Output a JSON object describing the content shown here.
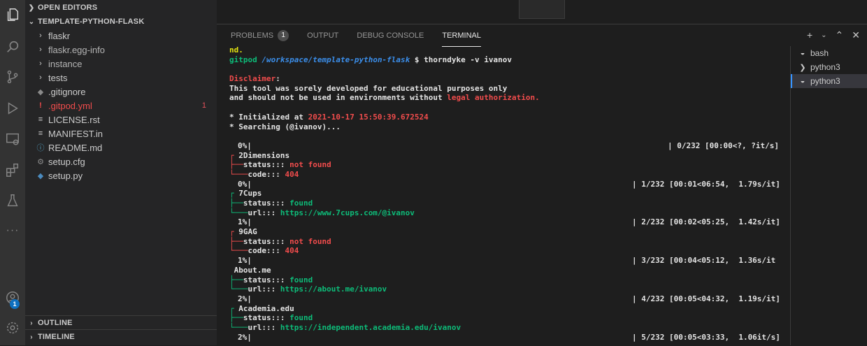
{
  "sidebar": {
    "open_editors": "OPEN EDITORS",
    "project": "TEMPLATE-PYTHON-FLASK",
    "items": [
      {
        "label": "flaskr",
        "type": "folder"
      },
      {
        "label": "flaskr.egg-info",
        "type": "folder"
      },
      {
        "label": "instance",
        "type": "folder"
      },
      {
        "label": "tests",
        "type": "folder"
      },
      {
        "label": ".gitignore",
        "type": "file"
      },
      {
        "label": ".gitpod.yml",
        "type": "file",
        "count": "1"
      },
      {
        "label": "LICENSE.rst",
        "type": "file"
      },
      {
        "label": "MANIFEST.in",
        "type": "file"
      },
      {
        "label": "README.md",
        "type": "file"
      },
      {
        "label": "setup.cfg",
        "type": "file"
      },
      {
        "label": "setup.py",
        "type": "file"
      }
    ],
    "outline": "OUTLINE",
    "timeline": "TIMELINE"
  },
  "activity": {
    "account_badge": "1"
  },
  "panel": {
    "tabs": [
      {
        "label": "PROBLEMS",
        "count": "1"
      },
      {
        "label": "OUTPUT"
      },
      {
        "label": "DEBUG CONSOLE"
      },
      {
        "label": "TERMINAL"
      }
    ]
  },
  "terminals": [
    {
      "label": "bash"
    },
    {
      "label": "python3"
    },
    {
      "label": "python3"
    }
  ],
  "terminal": {
    "l0": "nd.",
    "prompt_user": "gitpod",
    "prompt_path": "/workspace/template-python-flask",
    "prompt_cmd": " $ thorndyke -v ivanov",
    "disclaimer": "Disclaimer",
    "colon": ":",
    "line_a": "This tool was sorely developed for educational purposes only",
    "line_b": "and should not be used in environments without ",
    "legal": "legal authorization.",
    "init_prefix": "* Initialized at ",
    "init_time": "2021-10-17 15:50:39.672524",
    "search": "* Searching (@ivanov)...",
    "p0": "0%|",
    "p0r": "| 0/232 [00:00<?, ?it/s]",
    "s1": "2Dimensions",
    "st": "status::: ",
    "nf": "not found",
    "cd": "code::: ",
    "c404": "404",
    "p1": "0%|",
    "p1r": "| 1/232 [00:01<06:54,  1.79s/it]",
    "s2": "7Cups",
    "found": "found",
    "url": "url::: ",
    "u2": "https://www.7cups.com/@ivanov",
    "p2": "1%|",
    "p2r": "| 2/232 [00:02<05:25,  1.42s/it]",
    "s3": "9GAG",
    "p3": "1%|",
    "p3r": "| 3/232 [00:04<05:12,  1.36s/it",
    "s4": "About.me",
    "u4": "https://about.me/ivanov",
    "p4": "2%|",
    "p4r": "| 4/232 [00:05<04:32,  1.19s/it]",
    "s5": "Academia.edu",
    "u5": "https://independent.academia.edu/ivanov",
    "p5": "2%|",
    "p5r": "| 5/232 [00:05<03:33,  1.06it/s]"
  }
}
